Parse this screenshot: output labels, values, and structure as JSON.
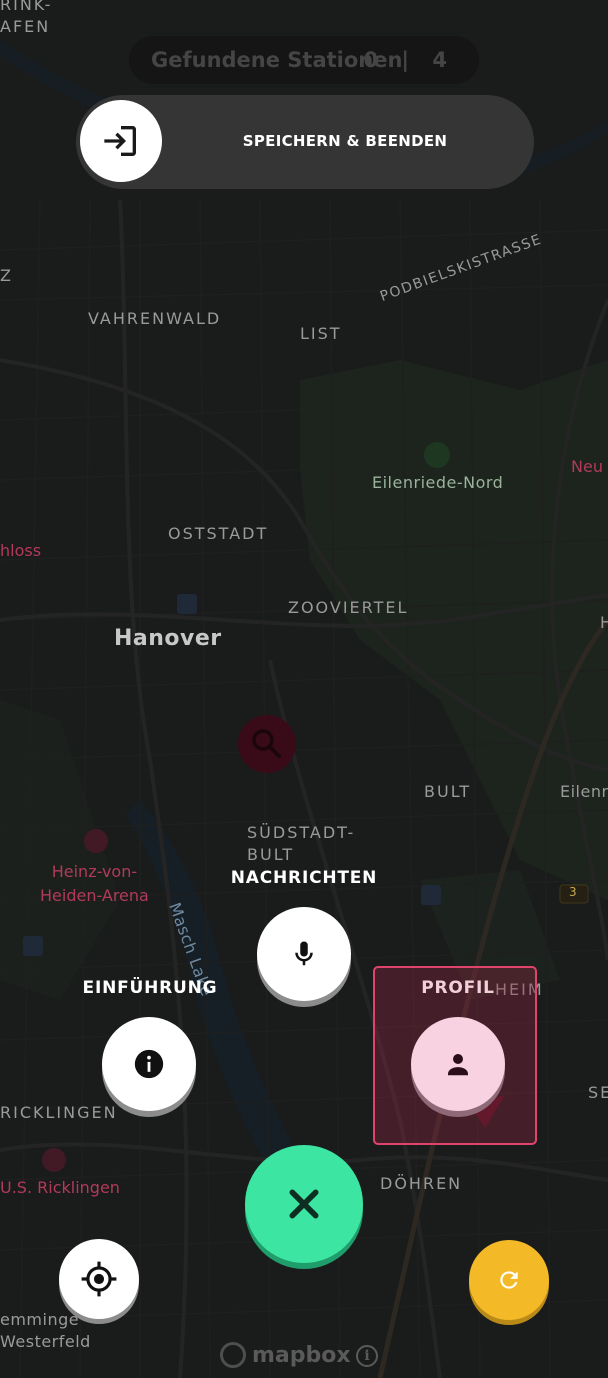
{
  "header": {
    "counter_label": "Gefundene Stationen",
    "counter_value": "0 | 4",
    "save_label": "SPEICHERN & BEENDEN"
  },
  "map": {
    "labels": {
      "top_left": "RINK-\nAFEN",
      "vahrenwald": "VAHRENWALD",
      "list": "LIST",
      "podbielski": "PODBIELSKISTRASSE",
      "eilenriede_nord": "Eilenriede-Nord",
      "neu": "Neu",
      "oststadt": "OSTSTADT",
      "schloss": "hloss",
      "zooviertel": "ZOOVIERTEL",
      "hanover": "Hanover",
      "bult": "BULT",
      "eilenr": "Eilenr",
      "suedstadt": "SÜDSTADT-\nBULT",
      "heinz": "Heinz-von-\nHeiden-Arena",
      "masch_lake": "Masch Lake",
      "road_3": "3",
      "heim": "HEIM",
      "ricklingen": "RICKLINGEN",
      "se": "SE",
      "us_ricklingen": "U.S. Ricklingen",
      "doehren": "DÖHREN",
      "wettbergen": "emminge\nWesterfeld",
      "z": "Z",
      "h": "H"
    },
    "attribution": "mapbox",
    "attribution_info": "i"
  },
  "menu": {
    "nachrichten_label": "NACHRICHTEN",
    "einfuehrung_label": "EINFÜHRUNG",
    "profil_label": "PROFIL"
  },
  "colors": {
    "close_fab": "#3ce5a2",
    "refresh_fab": "#f3b927",
    "highlight_border": "#e0446d",
    "search_marker": "#c0103d"
  },
  "icons": {
    "save": "exit-to-app-icon",
    "nachrichten": "microphone-icon",
    "einfuehrung": "info-icon",
    "profil": "person-icon",
    "close": "close-icon",
    "refresh": "refresh-icon",
    "locate": "gps-crosshair-icon",
    "search_marker": "search-icon",
    "park": "tree-icon"
  }
}
